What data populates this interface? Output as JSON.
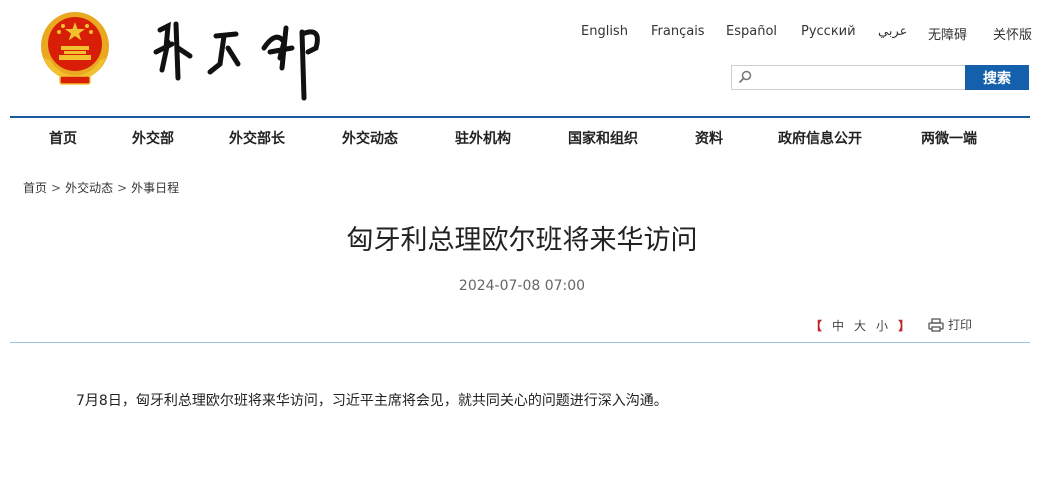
{
  "header": {
    "languages": [
      "English",
      "Français",
      "Español",
      "Русский",
      "عربي",
      "无障碍",
      "关怀版"
    ],
    "search": {
      "placeholder": "",
      "button_label": "搜索"
    }
  },
  "nav": {
    "items": [
      "首页",
      "外交部",
      "外交部长",
      "外交动态",
      "驻外机构",
      "国家和组织",
      "资料",
      "政府信息公开",
      "两微一端"
    ]
  },
  "breadcrumb": [
    "首页",
    "外交动态",
    "外事日程"
  ],
  "article": {
    "title": "匈牙利总理欧尔班将来华访问",
    "date": "2024-07-08 07:00",
    "font_size": {
      "open_bracket": "【",
      "large": "中",
      "medium": "大",
      "small": "小",
      "close_bracket": "】"
    },
    "print_label": "打印",
    "body": "7月8日，匈牙利总理欧尔班将来华访问，习近平主席将会见，就共同关心的问题进行深入沟通。"
  },
  "colors": {
    "nav_line": "#1a5a9f",
    "search_button": "#1560ad",
    "emblem_red": "#d81e06",
    "emblem_gold": "#f2c12e"
  }
}
